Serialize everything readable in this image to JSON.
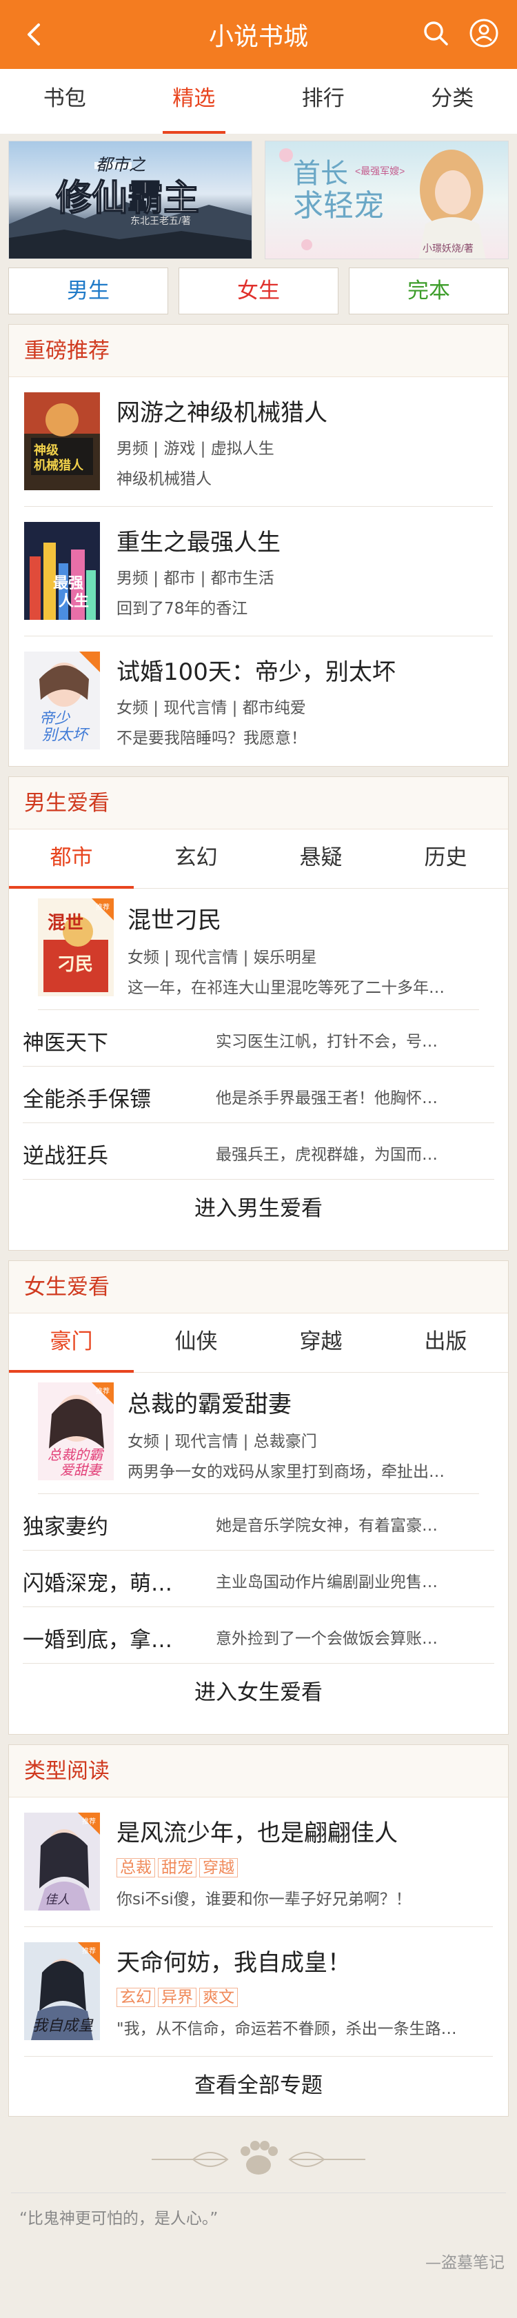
{
  "header": {
    "title": "小说书城"
  },
  "nav": [
    "书包",
    "精选",
    "排行",
    "分类"
  ],
  "banners": [
    {
      "top": "都市之",
      "main": "修仙霸主",
      "author": "东北王老五/著"
    },
    {
      "top": "首长",
      "tag": "<最强军嫂>",
      "main": "求轻宠",
      "author": "小璟妖烧/著"
    }
  ],
  "gender_buttons": [
    "男生",
    "女生",
    "完本"
  ],
  "colors": {
    "accent": "#f47c20",
    "active": "#e8451f",
    "male": "#1f7ac8",
    "female": "#e0302b",
    "finished": "#3d9d2a"
  },
  "recommend": {
    "title": "重磅推荐",
    "books": [
      {
        "title": "网游之神级机械猎人",
        "meta": "男频 | 游戏 | 虚拟人生",
        "desc": "神级机械猎人"
      },
      {
        "title": "重生之最强人生",
        "meta": "男频 | 都市 | 都市生活",
        "desc": "回到了78年的香江"
      },
      {
        "title": "试婚100天：帝少，别太坏",
        "meta": "女频 | 现代言情 | 都市纯爱",
        "desc": "不是要我陪睡吗？我愿意！"
      }
    ]
  },
  "male": {
    "title": "男生爱看",
    "tabs": [
      "都市",
      "玄幻",
      "悬疑",
      "历史"
    ],
    "feature": {
      "title": "混世刁民",
      "meta": "女频 | 现代言情 | 娱乐明星",
      "desc": "这一年，在祁连大山里混吃等死了二十多年…"
    },
    "rows": [
      {
        "name": "神医天下",
        "desc": "实习医生江帆，打针不会，号…"
      },
      {
        "name": "全能杀手保镖",
        "desc": "他是杀手界最强王者！他胸怀…"
      },
      {
        "name": "逆战狂兵",
        "desc": "最强兵王，虎视群雄，为国而…"
      }
    ],
    "more": "进入男生爱看"
  },
  "female": {
    "title": "女生爱看",
    "tabs": [
      "豪门",
      "仙侠",
      "穿越",
      "出版"
    ],
    "feature": {
      "title": "总裁的霸爱甜妻",
      "meta": "女频 | 现代言情 | 总裁豪门",
      "desc": "两男争一女的戏码从家里打到商场，牵扯出…"
    },
    "rows": [
      {
        "name": "独家妻约",
        "desc": "她是音乐学院女神，有着富豪…"
      },
      {
        "name": "闪婚深宠，萌…",
        "desc": "主业岛国动作片编剧副业兜售…"
      },
      {
        "name": "一婚到底，拿…",
        "desc": "意外捡到了一个会做饭会算账…"
      }
    ],
    "more": "进入女生爱看"
  },
  "type_read": {
    "title": "类型阅读",
    "books": [
      {
        "title": "是风流少年，也是翩翩佳人",
        "tags": [
          "总裁",
          "甜宠",
          "穿越"
        ],
        "desc": "你si不si傻，谁要和你一辈子好兄弟啊？！"
      },
      {
        "title": "天命何妨，我自成皇！",
        "tags": [
          "玄幻",
          "异界",
          "爽文"
        ],
        "desc": "\"我，从不信命，命运若不眷顾，杀出一条生路…"
      }
    ],
    "more": "查看全部专题"
  },
  "cover_badge": "推荐",
  "footer": {
    "quote": "“比鬼神更可怕的，是人心。”",
    "author": "—盗墓笔记"
  }
}
